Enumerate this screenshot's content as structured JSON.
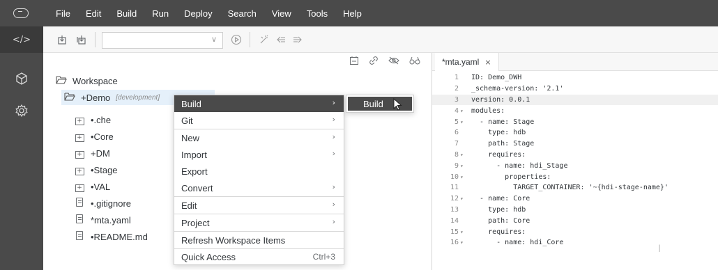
{
  "menubar": [
    "File",
    "Edit",
    "Build",
    "Run",
    "Deploy",
    "Search",
    "View",
    "Tools",
    "Help"
  ],
  "activity": {
    "code_label": "</>"
  },
  "workspace": {
    "root": "Workspace",
    "project": "+Demo",
    "project_tag": "[development]",
    "items": [
      {
        "label": "•.che",
        "type": "folder"
      },
      {
        "label": "•Core",
        "type": "folder"
      },
      {
        "label": "+DM",
        "type": "folder"
      },
      {
        "label": "•Stage",
        "type": "folder"
      },
      {
        "label": "•VAL",
        "type": "folder"
      },
      {
        "label": "•.gitignore",
        "type": "file"
      },
      {
        "label": "*mta.yaml",
        "type": "file"
      },
      {
        "label": "•README.md",
        "type": "file"
      }
    ]
  },
  "context_menu": {
    "items": [
      {
        "label": "Build",
        "submenu": true,
        "highlighted": true
      },
      {
        "label": "Git",
        "submenu": true
      },
      {
        "label": "New",
        "submenu": true
      },
      {
        "label": "Import",
        "submenu": true
      },
      {
        "label": "Export",
        "submenu": false
      },
      {
        "label": "Convert",
        "submenu": true
      },
      {
        "label": "Edit",
        "submenu": true
      },
      {
        "label": "Project",
        "submenu": true
      },
      {
        "label": "Refresh Workspace Items",
        "submenu": false
      },
      {
        "label": "Quick Access",
        "submenu": false,
        "shortcut": "Ctrl+3"
      }
    ],
    "submenu_item": "Build"
  },
  "editor": {
    "tab_label": "*mta.yaml",
    "lines": [
      {
        "n": "1",
        "fold": false,
        "text": "ID: Demo_DWH"
      },
      {
        "n": "2",
        "fold": false,
        "text": "_schema-version: '2.1'"
      },
      {
        "n": "3",
        "fold": false,
        "text": "version: 0.0.1",
        "current": true
      },
      {
        "n": "4",
        "fold": true,
        "text": "modules:"
      },
      {
        "n": "5",
        "fold": true,
        "text": "  - name: Stage"
      },
      {
        "n": "6",
        "fold": false,
        "text": "    type: hdb"
      },
      {
        "n": "7",
        "fold": false,
        "text": "    path: Stage"
      },
      {
        "n": "8",
        "fold": true,
        "text": "    requires:"
      },
      {
        "n": "9",
        "fold": true,
        "text": "      - name: hdi_Stage"
      },
      {
        "n": "10",
        "fold": true,
        "text": "        properties:"
      },
      {
        "n": "11",
        "fold": false,
        "text": "          TARGET_CONTAINER: '~{hdi-stage-name}'"
      },
      {
        "n": "12",
        "fold": true,
        "text": "  - name: Core"
      },
      {
        "n": "13",
        "fold": false,
        "text": "    type: hdb"
      },
      {
        "n": "14",
        "fold": false,
        "text": "    path: Core"
      },
      {
        "n": "15",
        "fold": true,
        "text": "    requires:"
      },
      {
        "n": "16",
        "fold": true,
        "text": "      - name: hdi_Core"
      }
    ]
  }
}
